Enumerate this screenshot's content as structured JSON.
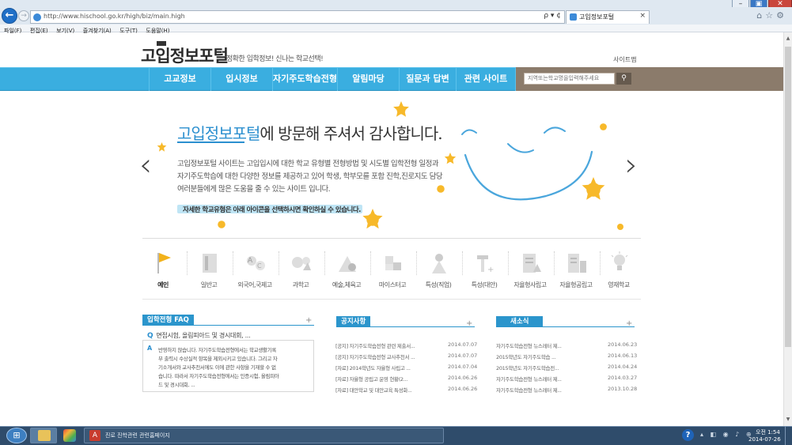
{
  "browser": {
    "url": "http://www.hischool.go.kr/high/biz/main.high",
    "address_tools": "ρ ▾ ¢",
    "tab_title": "고입정보포털",
    "menu": [
      "파일(F)",
      "편집(E)",
      "보기(V)",
      "즐겨찾기(A)",
      "도구(T)",
      "도움말(H)"
    ],
    "icons": [
      "back-arrow-icon",
      "forward-arrow-icon",
      "home-icon",
      "star-icon",
      "gear-icon"
    ]
  },
  "site": {
    "logo": "고입정보포털",
    "tagline": "정확한 입학정보! 신나는 학교선택!",
    "sitemap": "사이트맵",
    "nav": [
      "고교정보",
      "입시정보",
      "자기주도학습전형",
      "알림마당",
      "질문과 답변",
      "관련 사이트"
    ],
    "search_placeholder": "지역또는학교명을입력해주세요"
  },
  "hero": {
    "title_highlight": "고입정보포털",
    "title_rest": "에 방문해 주셔서 감사합니다.",
    "lines": [
      "고입정보포털 사이트는 고입입시에 대한 학교 유형별 전형방법 및 시도별 입학전형 일정과",
      "자기주도학습에 대한 다양한 정보를 제공하고 있어 학생, 학부모를 포함 진학,진로지도 담당",
      "여러분들에게 많은 도움을 줄 수 있는 사이트 입니다."
    ],
    "note": "자세한 학교유형은 아래 아이콘을 선택하시면 확인하실 수 있습니다."
  },
  "categories": [
    {
      "label": "예인",
      "active": true
    },
    {
      "label": "일반고",
      "active": false
    },
    {
      "label": "외국어,국제고",
      "active": false
    },
    {
      "label": "과학고",
      "active": false
    },
    {
      "label": "예술,체육고",
      "active": false
    },
    {
      "label": "마이스터고",
      "active": false
    },
    {
      "label": "특성(직업)",
      "active": false
    },
    {
      "label": "특성(대안)",
      "active": false
    },
    {
      "label": "자율형사립고",
      "active": false
    },
    {
      "label": "자율형공립고",
      "active": false
    },
    {
      "label": "영재학교",
      "active": false
    }
  ],
  "faq": {
    "heading": "입학전형 FAQ",
    "q_mark": "Q",
    "question": "면접시험, 올림피아드 및 경시대회, ...",
    "a_mark": "A",
    "answer_lines": [
      "반영하지 않습니다. 자기주도학습전형에서는 학교생활기록",
      "부 출력시 수상실적 항목을 제외시키고 있습니다. 그리고 자",
      "기소개서와 교사추천서에도 이에 관한 사항을 기재할 수 없",
      "습니다. 따라서 자기주도학습전형에서는 인증시험, 올림피아",
      "드 및 경시대회, ..."
    ]
  },
  "notices": {
    "heading": "공지사항",
    "items": [
      {
        "title": "[공지] 자기주도학습전형 관련 제출서...",
        "date": "2014.07.07"
      },
      {
        "title": "[공지] 자기주도학습전형 교사추천서 ...",
        "date": "2014.07.07"
      },
      {
        "title": "[자료] 2014학년도 자율형 사립고 ...",
        "date": "2014.07.04"
      },
      {
        "title": "[자료] 자율형 공립고 운영 현황(2...",
        "date": "2014.06.26"
      },
      {
        "title": "[자료] 대안학교 및 대안교육 특성화...",
        "date": "2014.06.26"
      }
    ]
  },
  "news": {
    "heading": "새소식",
    "items": [
      {
        "title": "자기주도학습전형 뉴스레터 제...",
        "date": "2014.06.23"
      },
      {
        "title": "2015학년도 자기주도학습 ...",
        "date": "2014.06.13"
      },
      {
        "title": "2015학년도 자기주도학습전...",
        "date": "2014.04.24"
      },
      {
        "title": "자기주도학습전형 뉴스레터 제...",
        "date": "2014.03.27"
      },
      {
        "title": "자기주도학습전형 뉴스레터 제...",
        "date": "2013.10.28"
      }
    ]
  },
  "taskbar": {
    "pdf_title": "진로 진학관련 관련홈페이지",
    "time": "오전 1:54",
    "date": "2014-07-26"
  },
  "colors": {
    "nav_blue": "#3aaee0",
    "nav_brown": "#8b7b6b",
    "accent_blue": "#2b95cc",
    "star_yellow": "#f7b92a",
    "smile_blue": "#4aa6dc"
  }
}
